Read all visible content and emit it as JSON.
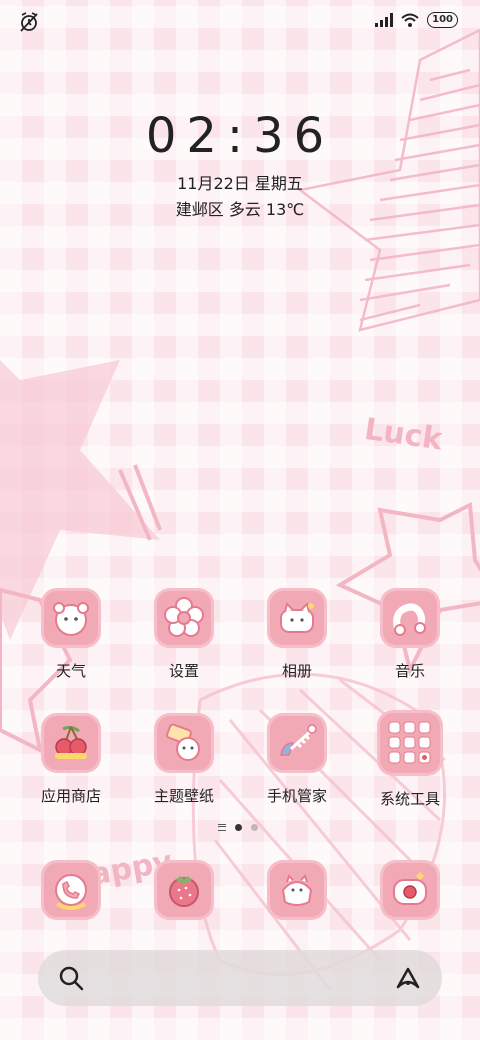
{
  "status_bar": {
    "left_icon": "alarm-off-icon",
    "battery": "100",
    "signal_icon": "signal-icon",
    "wifi_icon": "wifi-icon"
  },
  "clock": {
    "time": "02:36",
    "date": "11月22日 星期五",
    "weather": "建邺区 多云 13℃"
  },
  "wallpaper_text": {
    "luck": "Luck",
    "happy": "Happy"
  },
  "apps_row1": [
    {
      "label": "天气",
      "icon": "weather-bear-icon"
    },
    {
      "label": "设置",
      "icon": "settings-flower-icon"
    },
    {
      "label": "相册",
      "icon": "gallery-cat-icon"
    },
    {
      "label": "音乐",
      "icon": "music-note-icon"
    }
  ],
  "apps_row2": [
    {
      "label": "应用商店",
      "icon": "cherry-icon"
    },
    {
      "label": "主题壁纸",
      "icon": "theme-cat-icon"
    },
    {
      "label": "手机管家",
      "icon": "fishbone-icon"
    },
    {
      "label": "系统工具",
      "icon": "tools-folder-icon"
    }
  ],
  "dock": [
    {
      "icon": "phone-icon"
    },
    {
      "icon": "strawberry-icon"
    },
    {
      "icon": "messages-cat-icon"
    },
    {
      "icon": "camera-icon"
    }
  ],
  "search": {
    "search_icon": "search-icon",
    "assistant_icon": "assistant-icon"
  },
  "colors": {
    "background": "#fbe4ea",
    "icon_tile": "#f2a9b6",
    "accent": "#e46f86"
  }
}
